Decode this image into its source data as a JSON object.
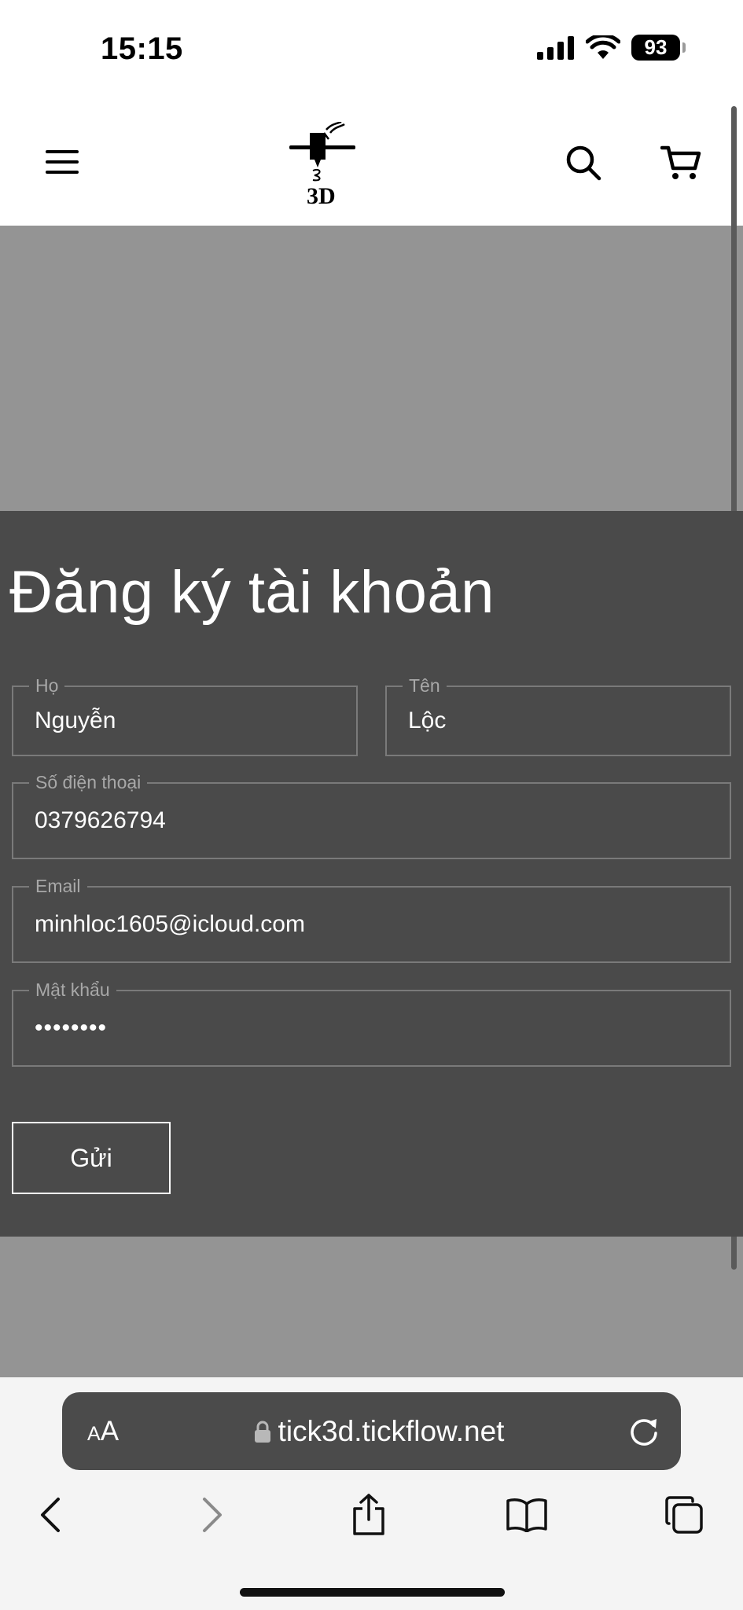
{
  "status_bar": {
    "time": "15:15",
    "battery": "93"
  },
  "header": {
    "logo_text": "3D",
    "icons": [
      "hamburger-menu-icon",
      "search-icon",
      "cart-icon"
    ]
  },
  "form": {
    "title": "Đăng ký tài khoản",
    "last_name": {
      "label": "Họ",
      "value": "Nguyễn"
    },
    "first_name": {
      "label": "Tên",
      "value": "Lộc"
    },
    "phone": {
      "label": "Số điện thoại",
      "value": "0379626794"
    },
    "email": {
      "label": "Email",
      "value": "minhloc1605@icloud.com"
    },
    "password": {
      "label": "Mật khẩu",
      "value": "••••••••"
    },
    "submit_label": "Gửi"
  },
  "browser": {
    "aa_small": "A",
    "aa_big": "A",
    "url": "tick3d.tickflow.net"
  },
  "colors": {
    "panel": "#4a4a4a",
    "overlay": "#949494",
    "address_bar": "#4b4b4b"
  }
}
